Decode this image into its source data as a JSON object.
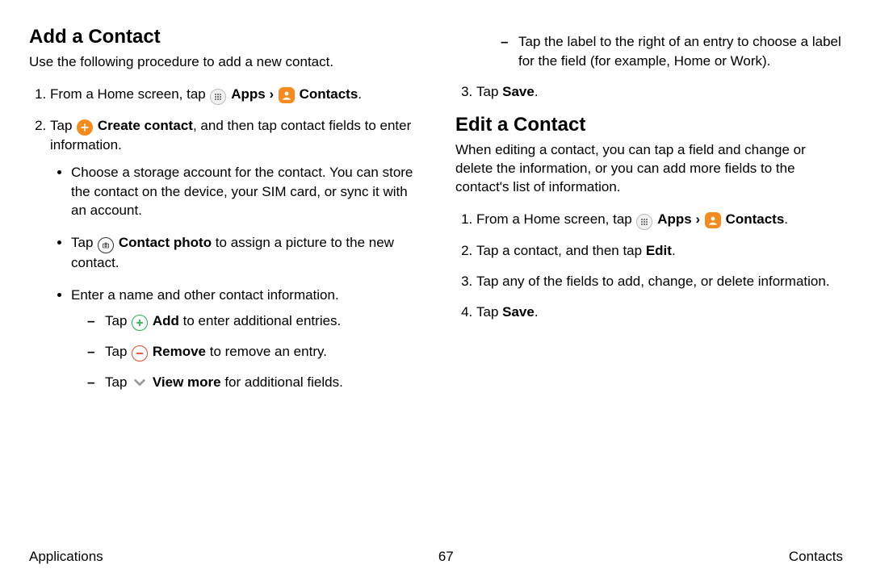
{
  "left": {
    "heading": "Add a Contact",
    "intro": "Use the following procedure to add a new contact.",
    "step1_a": "From a Home screen, tap ",
    "apps_label": "Apps",
    "chevron": " › ",
    "contacts_label": "Contacts",
    "period": ".",
    "step2_a": "Tap ",
    "create_label": "Create contact",
    "step2_b": ", and then tap contact fields to enter information.",
    "b1": "Choose a storage account for the contact. You can store the contact on the device, your SIM card, or sync it with an account.",
    "b2_a": "Tap ",
    "contact_photo_label": "Contact photo",
    "b2_b": " to assign a picture to the new contact.",
    "b3": "Enter a name and other contact information.",
    "d1_a": "Tap ",
    "add_label": "Add",
    "d1_b": " to enter additional entries.",
    "d2_a": "Tap ",
    "remove_label": "Remove",
    "d2_b": " to remove an entry.",
    "d3_a": "Tap ",
    "viewmore_label": "View more",
    "d3_b": " for additional fields."
  },
  "right": {
    "dash1": "Tap the label to the right of an entry to choose a label for the field (for example, Home or Work).",
    "step3_a": "Tap ",
    "save_label": "Save",
    "period": ".",
    "heading2": "Edit a Contact",
    "intro2": "When editing a contact, you can tap a field and change or delete the information, or you can add more fields to the contact's list of information.",
    "e1_a": "From a Home screen, tap ",
    "e2_a": "Tap a contact, and then tap ",
    "edit_label": "Edit",
    "e3": "Tap any of the fields to add, change, or delete information.",
    "e4_a": "Tap "
  },
  "footer": {
    "left": "Applications",
    "center": "67",
    "right": "Contacts"
  }
}
